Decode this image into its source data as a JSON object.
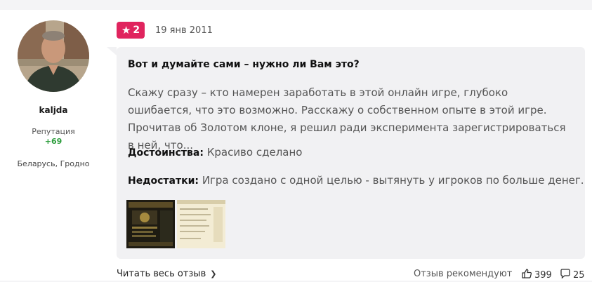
{
  "author": {
    "name": "kaljda",
    "reputation_label": "Репутация",
    "reputation_value": "+69",
    "location": "Беларусь, Гродно"
  },
  "review": {
    "rating": "2",
    "date": "19 янв 2011",
    "title": "Вот и думайте сами – нужно ли Вам это?",
    "text": "Скажу сразу – кто намерен заработать в этой онлайн игре, глубоко ошибается, что это возможно. Расскажу о собственном опыте в этой игре. Прочитав об Золотом клоне, я решил ради эксперимента зарегистрироваться в ней, что...",
    "pros_label": "Достоинства:",
    "pros": "Красиво сделано",
    "cons_label": "Недостатки:",
    "cons": "Игра создано с одной целью - вытянуть у игроков по больше денег."
  },
  "footer": {
    "read_full": "Читать весь отзыв",
    "recommend": "Отзыв рекомендуют",
    "likes": "399",
    "comments": "25"
  },
  "colors": {
    "badge": "#e0245e",
    "reputation": "#2e9e3e",
    "bubble": "#f1f1f3"
  },
  "icons": [
    "star-icon",
    "chevron-right-icon",
    "thumbs-up-icon",
    "comment-icon"
  ]
}
